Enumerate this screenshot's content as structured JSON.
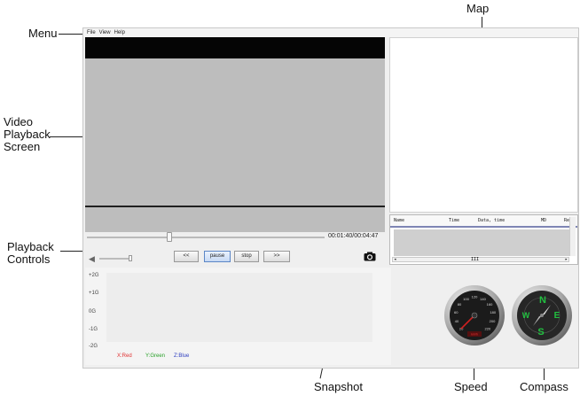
{
  "callouts": {
    "menu": "Menu",
    "map": "Map",
    "video_line1": "Video",
    "video_line2": "Playback",
    "video_line3": "Screen",
    "playback_line1": "Playback",
    "playback_line2": "Controls",
    "snapshot": "Snapshot",
    "speed": "Speed",
    "compass": "Compass"
  },
  "menubar": {
    "file": "File",
    "view": "View",
    "help": "Help"
  },
  "table": {
    "columns": [
      "Name",
      "Time",
      "Data, time",
      "MD",
      "Res"
    ],
    "scroll_mark": "III"
  },
  "playback": {
    "time": "00:01:40/00:04:47",
    "progress": 0.348,
    "volume": 1.0,
    "prev_label": "<<",
    "pause_label": "pause",
    "stop_label": "stop",
    "next_label": ">>"
  },
  "gsensor": {
    "yticks": [
      "+2G",
      "+1G",
      "0G",
      "-1G",
      "-2G"
    ],
    "legend": {
      "x": "X:Red",
      "y": "Y:Green",
      "z": "Z:Blue"
    },
    "colors": {
      "x": "#e03030",
      "y": "#28a028",
      "z": "#3040c0"
    }
  },
  "speedometer": {
    "ticks": [
      "20",
      "40",
      "60",
      "80",
      "100",
      "120",
      "140",
      "160",
      "180",
      "200",
      "220"
    ],
    "unit": "km/h",
    "value": 0
  },
  "compass": {
    "n": "N",
    "e": "E",
    "s": "S",
    "w": "W"
  },
  "icons": {
    "snapshot": "camera-icon",
    "volume": "speaker-icon"
  }
}
